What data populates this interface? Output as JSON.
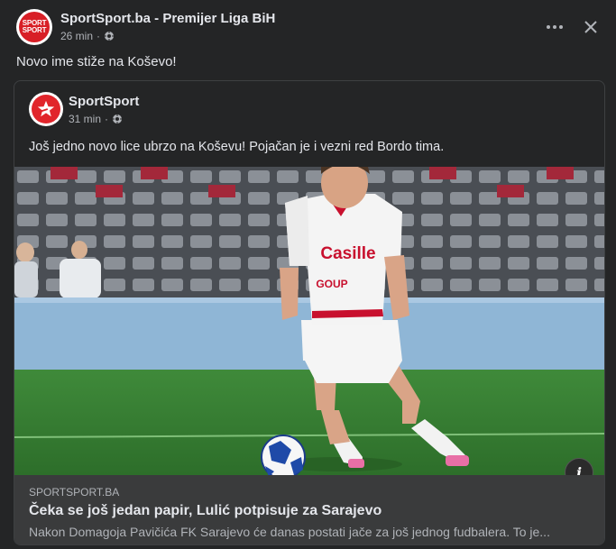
{
  "post": {
    "page_name": "SportSport.ba - Premijer Liga BiH",
    "time": "26 min",
    "separator": "·",
    "caption": "Novo ime stiže na Koševo!",
    "avatar_text_1": "SPORT",
    "avatar_text_2": "SPORT",
    "audience_icon": "globe-icon",
    "more_icon": "more-options-icon",
    "close_icon": "close-icon"
  },
  "shared_post": {
    "page_name": "SportSport",
    "time": "31 min",
    "separator": "·",
    "text": "Još jedno novo lice ubrzo na Koševu! Pojačan je i vezni red Bordo tima.",
    "audience_icon": "globe-icon"
  },
  "photo": {
    "jersey_sponsor": "Casille",
    "jersey_sponsor_2": "GOUP",
    "info_icon": "info-icon",
    "info_glyph": "i"
  },
  "link": {
    "domain": "SPORTSPORT.BA",
    "title": "Čeka se još jedan papir, Lulić potpisuje za Sarajevo",
    "description": "Nakon Domagoja Pavičića FK Sarajevo će danas postati jače za još jednog fudbalera. To je..."
  },
  "colors": {
    "background": "#242526",
    "card": "#3a3b3c",
    "text_primary": "#e4e6eb",
    "text_secondary": "#b0b3b8",
    "brand_red": "#d81f26"
  }
}
